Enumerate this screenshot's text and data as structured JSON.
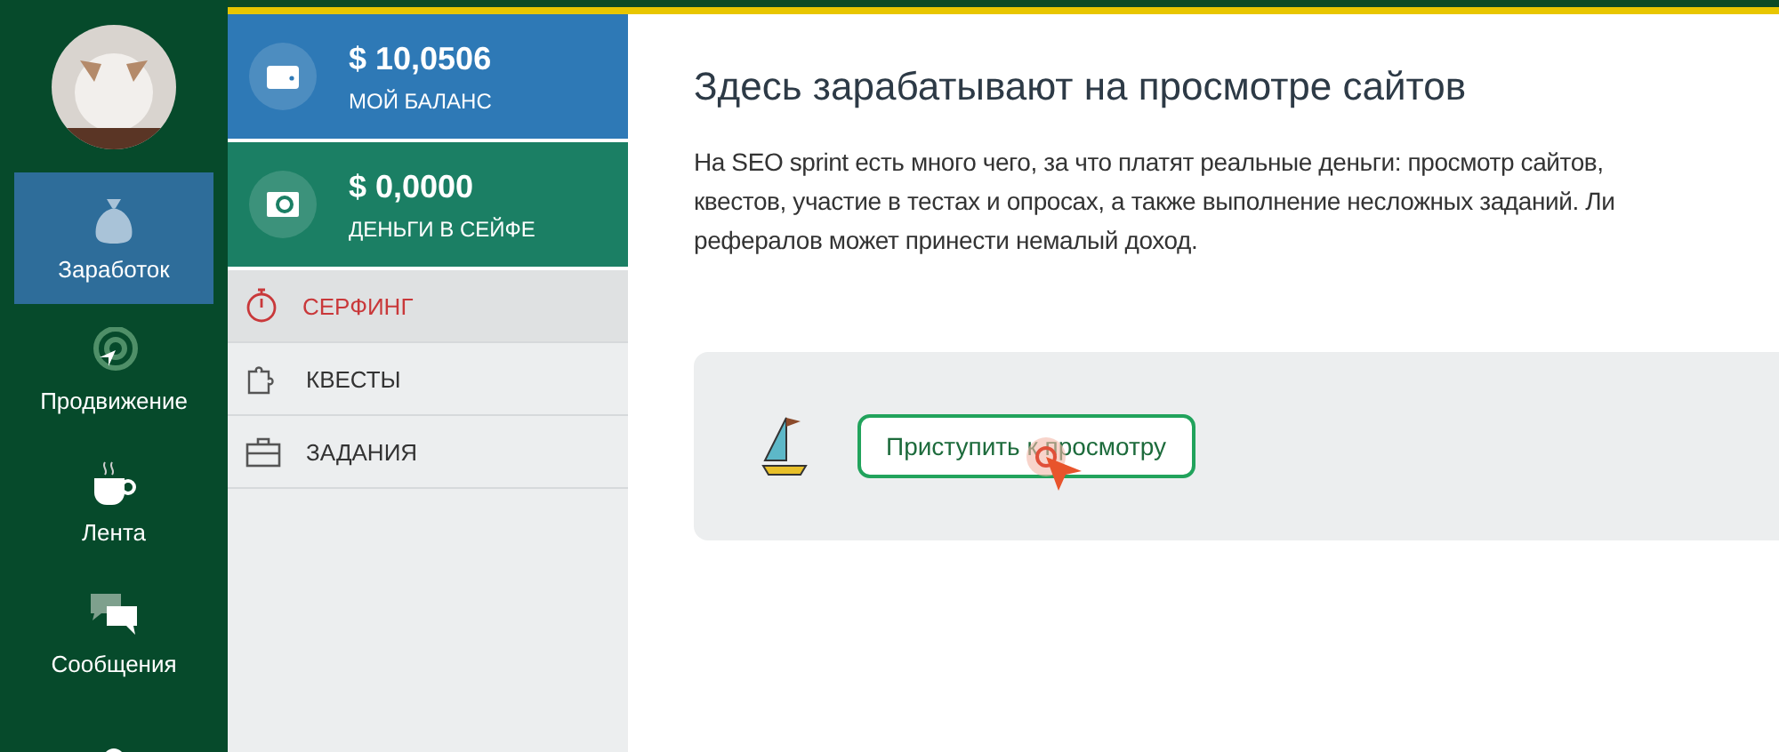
{
  "sidebar": {
    "items": [
      {
        "label": "Заработок",
        "selected": true
      },
      {
        "label": "Продвижение",
        "selected": false
      },
      {
        "label": "Лента",
        "selected": false
      },
      {
        "label": "Сообщения",
        "selected": false
      },
      {
        "selected": false
      }
    ]
  },
  "balances": [
    {
      "amount": "$ 10,0506",
      "label": "МОЙ БАЛАНС",
      "color": "#2e79b6"
    },
    {
      "amount": "$ 0,0000",
      "label": "ДЕНЬГИ В СЕЙФЕ",
      "color": "#1b7f64"
    }
  ],
  "submenu": [
    {
      "label": "СЕРФИНГ",
      "selected": true
    },
    {
      "label": "КВЕСТЫ",
      "selected": false
    },
    {
      "label": "ЗАДАНИЯ",
      "selected": false
    }
  ],
  "main": {
    "title": "Здесь зарабатывают на просмотре сайтов",
    "paragraph": [
      "На SEO sprint есть много чего, за что платят реальные деньги: просмотр сайтов,",
      "квестов, участие в тестах и опросах, а также выполнение несложных заданий. Ли",
      "рефералов может принести немалый доход."
    ],
    "start_button": "Приступить к просмотру"
  }
}
